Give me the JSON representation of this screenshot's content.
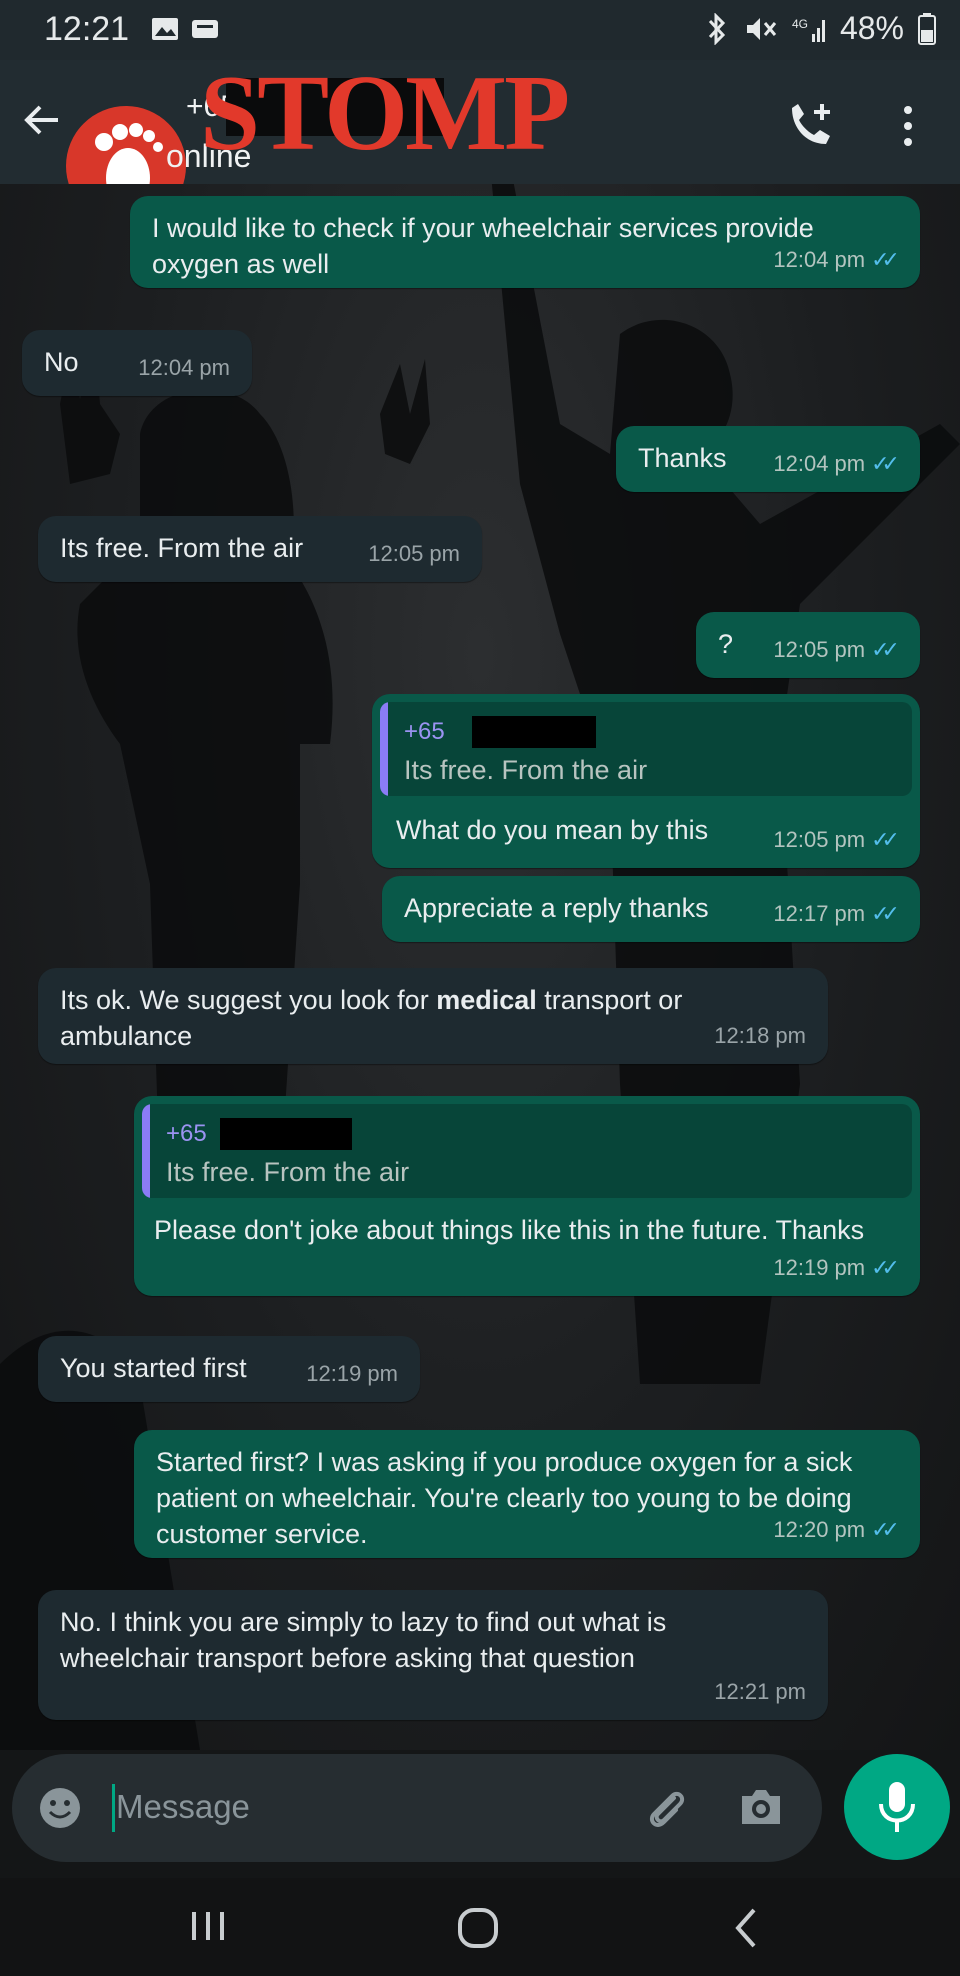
{
  "status_bar": {
    "time": "12:21",
    "battery": "48%"
  },
  "header": {
    "contact_prefix": "+65",
    "status": "online",
    "logo_text": "STOMP"
  },
  "messages": [
    {
      "dir": "out",
      "text": "I would like to check if your wheelchair services provide oxygen as well",
      "time": "12:04 pm"
    },
    {
      "dir": "in",
      "text": "No",
      "time": "12:04 pm"
    },
    {
      "dir": "out",
      "text": "Thanks",
      "time": "12:04 pm"
    },
    {
      "dir": "in",
      "text": "Its free. From the air",
      "time": "12:05 pm"
    },
    {
      "dir": "out",
      "text": "?",
      "time": "12:05 pm"
    },
    {
      "dir": "out",
      "quote_name": "+65",
      "quote_text": "Its free. From the air",
      "text": "What do you mean by this",
      "time": "12:05 pm"
    },
    {
      "dir": "out",
      "text": "Appreciate a reply thanks",
      "time": "12:17 pm"
    },
    {
      "dir": "in",
      "text_before": "Its ok. We suggest you look for ",
      "text_bold": "medical",
      "text_after": " transport or ambulance",
      "time": "12:18 pm"
    },
    {
      "dir": "out",
      "quote_name": "+65",
      "quote_text": "Its free. From the air",
      "text": "Please don't joke about things like this in the future. Thanks",
      "time": "12:19 pm"
    },
    {
      "dir": "in",
      "text": "You started first",
      "time": "12:19 pm"
    },
    {
      "dir": "out",
      "text": "Started first? I was asking if you produce oxygen for a sick patient on wheelchair. You're clearly too young to be doing customer service.",
      "time": "12:20 pm"
    },
    {
      "dir": "in",
      "text": "No. I think you are simply to lazy to find out what is wheelchair transport before asking that question",
      "time": "12:21 pm"
    }
  ],
  "input": {
    "placeholder": "Message"
  },
  "icons": [
    "back-arrow-icon",
    "add-call-icon",
    "more-vert-icon",
    "emoji-icon",
    "attach-icon",
    "camera-icon",
    "mic-icon",
    "recents-icon",
    "home-icon",
    "back-nav-icon"
  ],
  "colors": {
    "outgoing_bubble": "#095949",
    "incoming_bubble": "#1e2a30",
    "accent": "#00a884",
    "read_ticks": "#53bdeb",
    "logo": "#e2392b"
  }
}
